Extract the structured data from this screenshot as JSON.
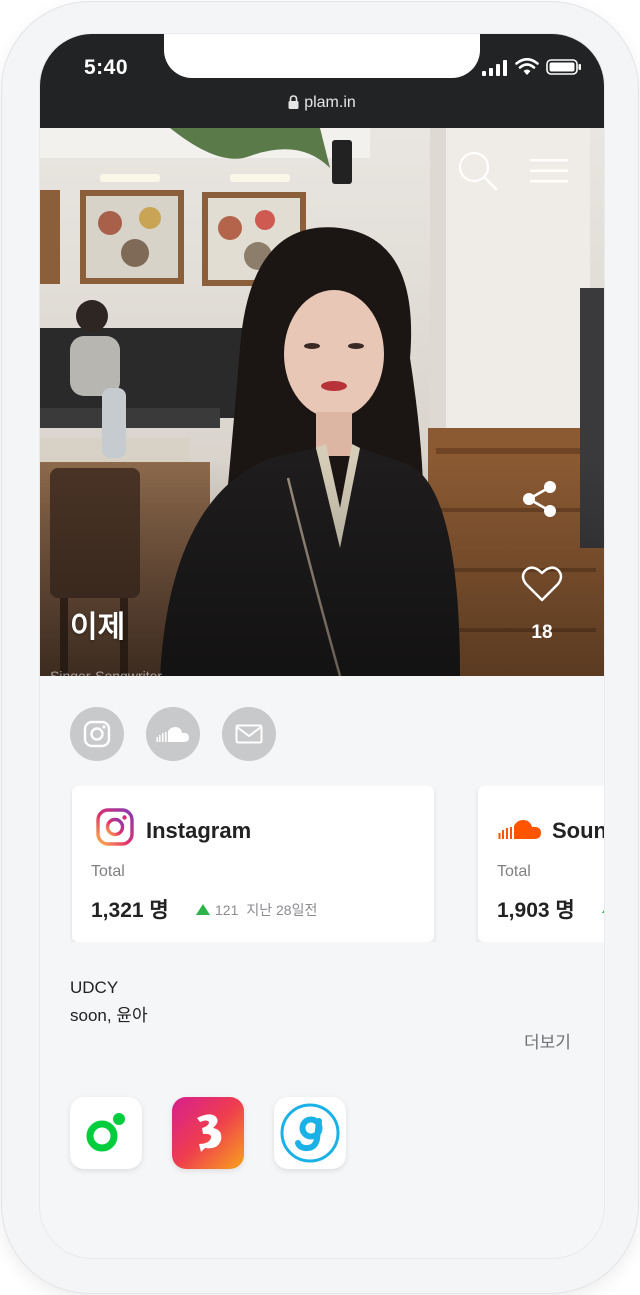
{
  "status_bar": {
    "time": "5:40",
    "url": "plam.in"
  },
  "profile": {
    "name": "이제",
    "sub_text": "Singer-Songwriter",
    "likes": "18"
  },
  "social_buttons": [
    "instagram-icon",
    "soundcloud-icon",
    "mail-icon"
  ],
  "cards": [
    {
      "platform": "Instagram",
      "total_label": "Total",
      "total_value": "1,321 명",
      "delta": "121",
      "delta_note": "지난 28일전",
      "accent": "#d62976"
    },
    {
      "platform": "SoundCloud",
      "total_label": "Total",
      "total_value": "1,903 명",
      "delta": "",
      "delta_note": "",
      "accent": "#ff5500"
    }
  ],
  "bio": {
    "line1": "UDCY",
    "line2": "soon, 윤아"
  },
  "more_label": "더보기",
  "apps": [
    "melon-icon",
    "bugs-icon",
    "genie-icon"
  ],
  "colors": {
    "status_bar": "#222324",
    "social_button": "#c8c9cb",
    "up_arrow": "#2eb34a",
    "melon": "#00cd3c",
    "genie": "#1ab1e6"
  }
}
